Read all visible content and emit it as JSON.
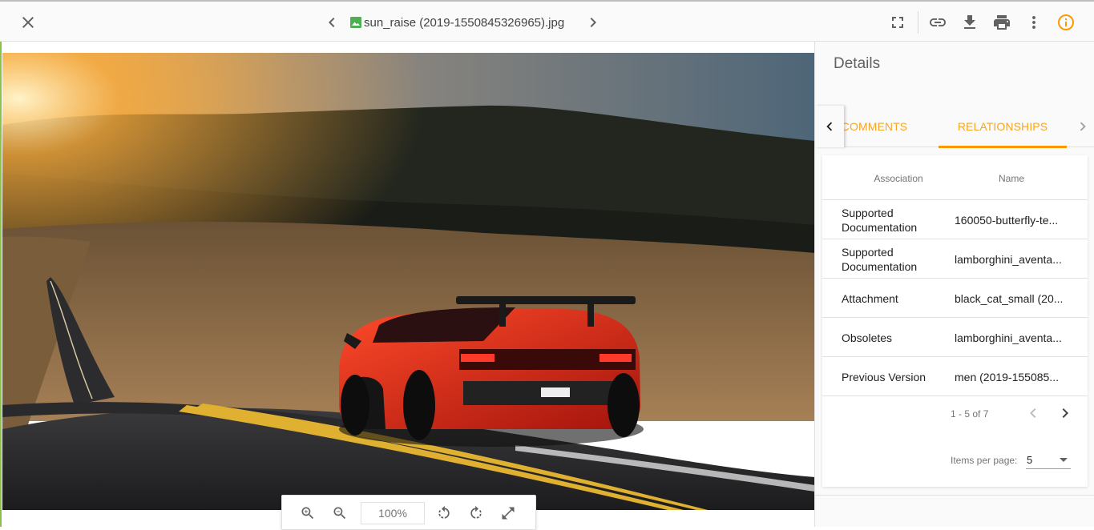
{
  "header": {
    "close_icon": "close-icon",
    "file_name": "sun_raise (2019-1550845326965).jpg",
    "file_type_icon": "image-file-icon",
    "file_icon_color": "#4caf50",
    "actions": [
      "fullscreen-icon",
      "link-icon",
      "download-icon",
      "print-icon",
      "more-vert-icon",
      "info-icon"
    ],
    "accent_color": "#ff9800"
  },
  "viewer": {
    "zoom_level": "100%",
    "toolbar_icons": [
      "zoom-in-icon",
      "zoom-out-icon",
      "rotate-left-icon",
      "rotate-right-icon",
      "fit-screen-icon"
    ]
  },
  "sidebar": {
    "title": "Details",
    "tabs": [
      {
        "label": "COMMENTS",
        "active": false
      },
      {
        "label": "RELATIONSHIPS",
        "active": true
      }
    ],
    "table": {
      "columns": [
        "Association",
        "Name"
      ],
      "rows": [
        {
          "association": "Supported Documentation",
          "name": "160050-butterfly-te..."
        },
        {
          "association": "Supported Documentation",
          "name": "lamborghini_aventa..."
        },
        {
          "association": "Attachment",
          "name": "black_cat_small (20..."
        },
        {
          "association": "Obsoletes",
          "name": "lamborghini_aventa..."
        },
        {
          "association": "Previous Version",
          "name": "men (2019-155085..."
        }
      ]
    },
    "paginator": {
      "range": "1 - 5 of 7",
      "items_per_page_label": "Items per page:",
      "items_per_page": "5"
    }
  }
}
